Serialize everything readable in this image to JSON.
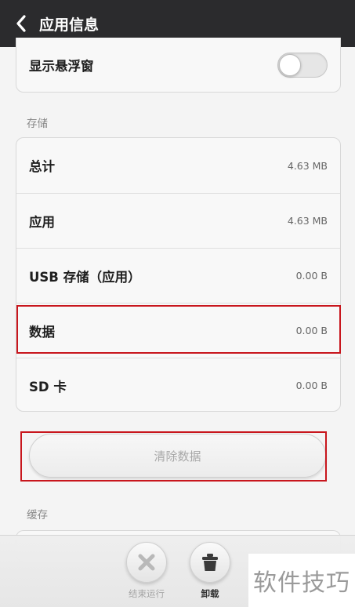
{
  "header": {
    "title": "应用信息"
  },
  "floating_window": {
    "label": "显示悬浮窗",
    "enabled": false
  },
  "storage": {
    "section_label": "存储",
    "rows": [
      {
        "label": "总计",
        "value": "4.63 MB"
      },
      {
        "label": "应用",
        "value": "4.63 MB"
      },
      {
        "label": "USB 存储（应用）",
        "value": "0.00 B"
      },
      {
        "label": "数据",
        "value": "0.00 B"
      },
      {
        "label": "SD 卡",
        "value": "0.00 B"
      }
    ],
    "clear_data_label": "清除数据"
  },
  "cache": {
    "section_label": "缓存"
  },
  "bottom_actions": {
    "force_stop_label": "结束运行",
    "uninstall_label": "卸载"
  },
  "watermark": {
    "text": "软件技巧"
  },
  "colors": {
    "titlebar": "#2b2b2d",
    "highlight": "#c8161d"
  }
}
